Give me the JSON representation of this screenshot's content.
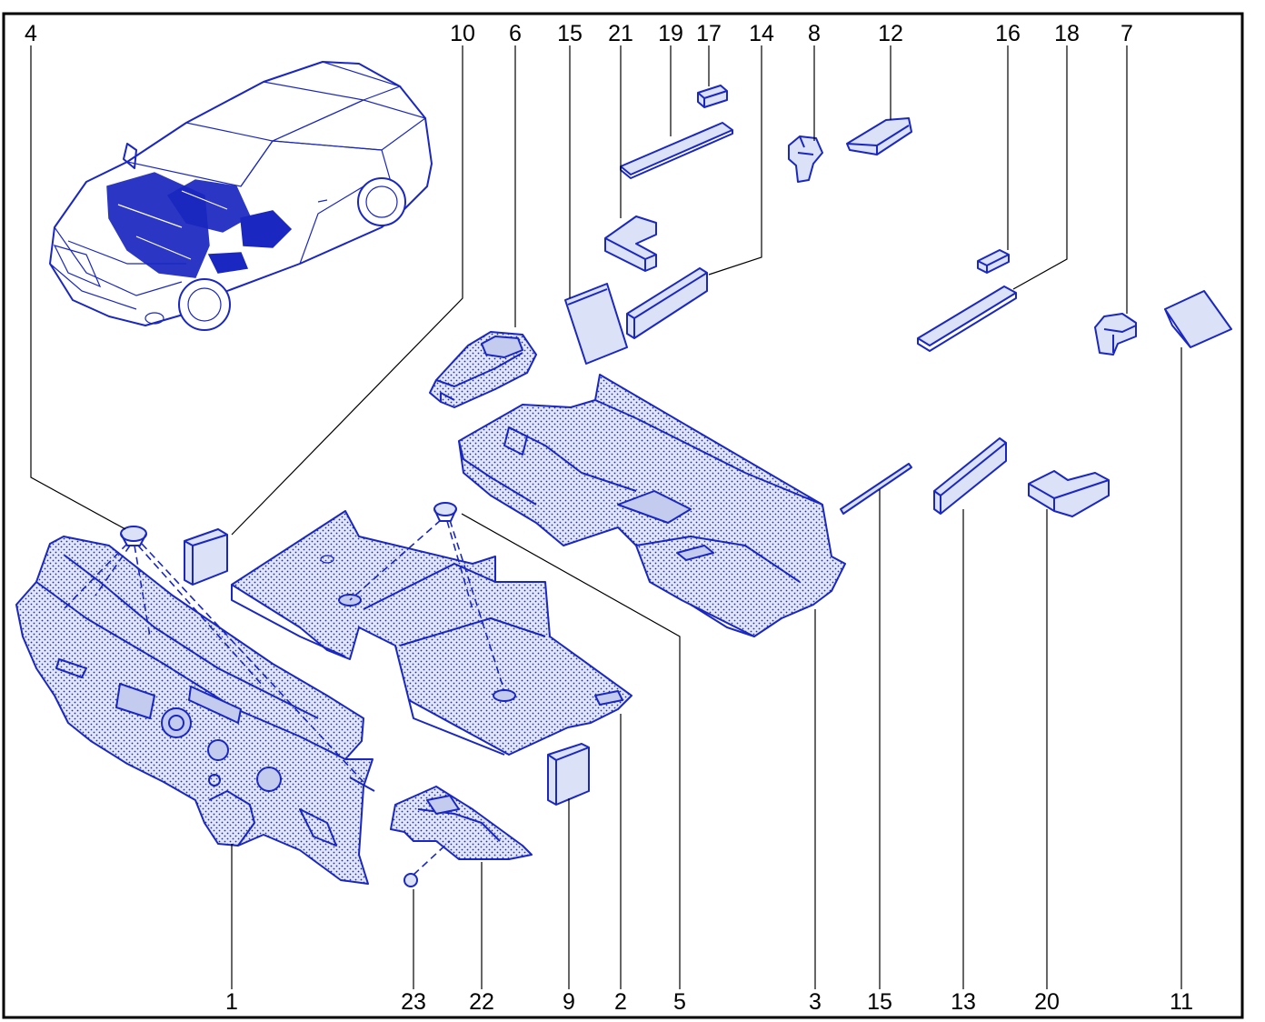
{
  "diagram": {
    "callouts": [
      "4",
      "10",
      "6",
      "15",
      "21",
      "19",
      "17",
      "14",
      "8",
      "12",
      "16",
      "18",
      "7",
      "1",
      "23",
      "22",
      "9",
      "2",
      "5",
      "3",
      "15",
      "13",
      "20",
      "11"
    ]
  }
}
